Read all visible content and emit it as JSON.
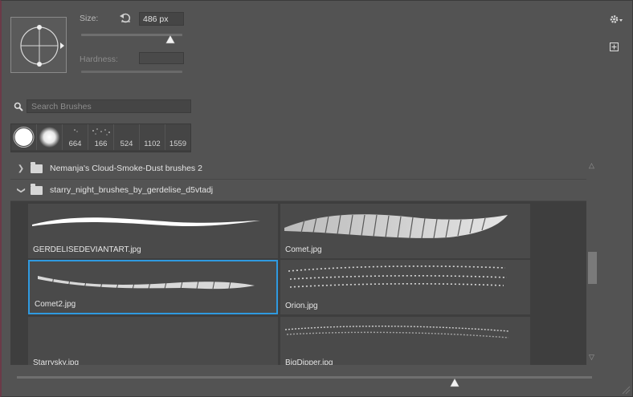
{
  "brush_settings": {
    "size_label": "Size:",
    "size_value": "486 px",
    "size_fraction": 0.87,
    "hardness_label": "Hardness:",
    "hardness_value": ""
  },
  "icons": {
    "reset": "reset-icon",
    "gear": "gear-icon",
    "new_brush": "new-brush-icon",
    "search": "search-icon"
  },
  "search": {
    "placeholder": "Search Brushes"
  },
  "recent_presets": [
    {
      "label": ""
    },
    {
      "label": ""
    },
    {
      "label": "664"
    },
    {
      "label": "166"
    },
    {
      "label": "524"
    },
    {
      "label": "1102"
    },
    {
      "label": "1559"
    }
  ],
  "groups": [
    {
      "name": "Nemanja's Cloud-Smoke-Dust brushes 2",
      "expanded": false
    },
    {
      "name": "starry_night_brushes_by_gerdelise_d5vtadj",
      "expanded": true
    }
  ],
  "brushes": [
    {
      "name": "GERDELISEDEVIANTART.jpg",
      "selected": false
    },
    {
      "name": "Comet.jpg",
      "selected": false
    },
    {
      "name": "Comet2.jpg",
      "selected": true
    },
    {
      "name": "Orion.jpg",
      "selected": false
    },
    {
      "name": "Starrysky.jpg",
      "selected": false
    },
    {
      "name": "BigDipper.jpg",
      "selected": false
    }
  ],
  "colors": {
    "accent": "#2f9ae0",
    "panel": "#535353"
  },
  "preview_zoom_fraction": 0.77
}
